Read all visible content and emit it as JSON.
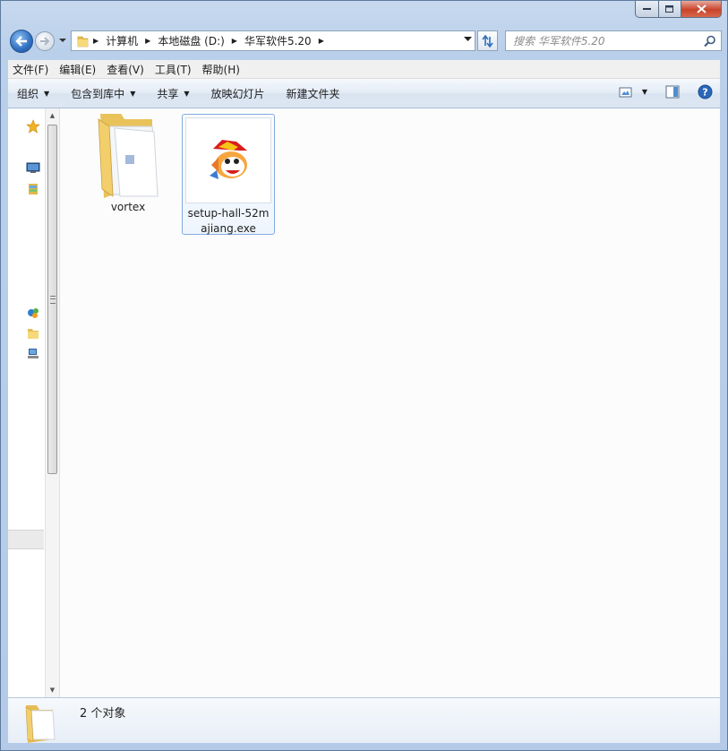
{
  "window": {
    "caption_buttons": [
      "minimize",
      "maximize",
      "close"
    ]
  },
  "address": {
    "crumbs": [
      "计算机",
      "本地磁盘 (D:)",
      "华军软件5.20"
    ],
    "search_placeholder": "搜索 华军软件5.20"
  },
  "menu": {
    "items": [
      "文件(F)",
      "编辑(E)",
      "查看(V)",
      "工具(T)",
      "帮助(H)"
    ]
  },
  "toolbar": {
    "organize": "组织",
    "include_in_library": "包含到库中",
    "share": "共享",
    "slideshow": "放映幻灯片",
    "new_folder": "新建文件夹"
  },
  "files": [
    {
      "name": "vortex",
      "type": "folder",
      "selected": false
    },
    {
      "name": "setup-hall-52majiang.exe",
      "type": "exe",
      "selected": true
    }
  ],
  "details": {
    "count_text": "2 个对象"
  },
  "colors": {
    "accent": "#2f6fc0",
    "folder": "#f2cf6b",
    "close_button": "#c7432a"
  }
}
